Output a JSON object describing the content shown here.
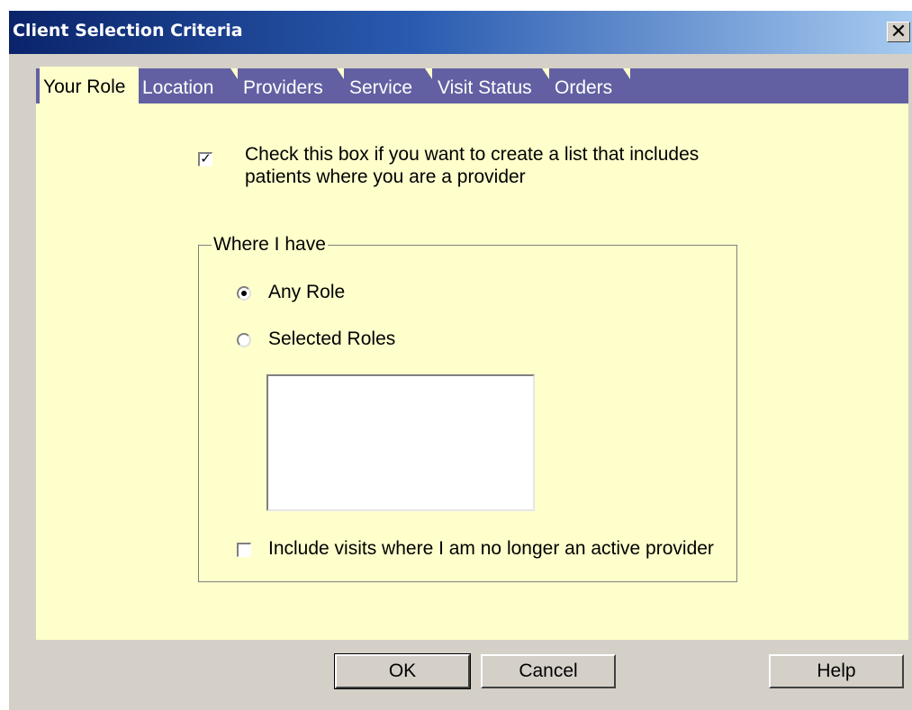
{
  "window": {
    "title": "Client Selection Criteria",
    "close_icon": "close-icon",
    "close_glyph": "✕"
  },
  "tabs": [
    {
      "label": "Your Role",
      "active": true
    },
    {
      "label": "Location",
      "active": false
    },
    {
      "label": "Providers",
      "active": false
    },
    {
      "label": "Service",
      "active": false
    },
    {
      "label": "Visit Status",
      "active": false
    },
    {
      "label": "Orders",
      "active": false
    }
  ],
  "your_role": {
    "provider_checkbox": {
      "checked": true,
      "check_glyph": "✓",
      "label": "Check this box if you want to create a list that includes patients where you are a provider"
    },
    "group_label": "Where I have",
    "radios": [
      {
        "label": "Any Role",
        "selected": true
      },
      {
        "label": "Selected Roles",
        "selected": false
      }
    ],
    "roles_list": [],
    "inactive_checkbox": {
      "checked": false,
      "label": "Include visits where I am no longer an active provider"
    }
  },
  "buttons": {
    "ok": "OK",
    "cancel": "Cancel",
    "help": "Help"
  },
  "colors": {
    "panel_bg": "#ffffcc",
    "tab_strip": "#6260a2",
    "title_gradient_start": "#0a246a",
    "title_gradient_end": "#a6caf0",
    "dialog_face": "#d4d0c8"
  }
}
